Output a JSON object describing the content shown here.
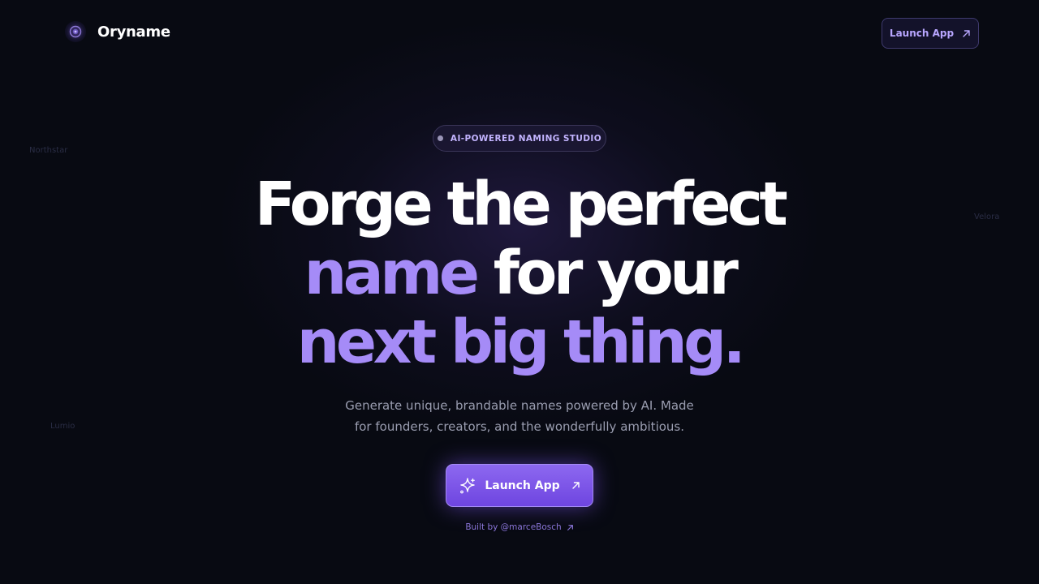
{
  "brand": {
    "name": "Oryname",
    "logo_icon": "orb-icon",
    "accent_color": "#a58bf7"
  },
  "header": {
    "launch_label": "Launch App",
    "launch_icon": "arrow-up-right-icon"
  },
  "background_words": [
    "Northstar",
    "Velora",
    "Lumio"
  ],
  "hero": {
    "badge": "AI-POWERED NAMING STUDIO",
    "headline": {
      "line1": "Forge the perfect",
      "line2_accent": "name",
      "line2_rest": " for your",
      "line3_accent": "next big thing."
    },
    "subtitle_line1": "Generate unique, brandable names powered by AI. Made",
    "subtitle_line2": "for founders, creators, and the wonderfully ambitious.",
    "cta_label": "Launch App",
    "cta_icon": "sparkles-icon",
    "cta_arrow_icon": "arrow-up-right-icon",
    "built_by": "Built by @marceBosch"
  }
}
